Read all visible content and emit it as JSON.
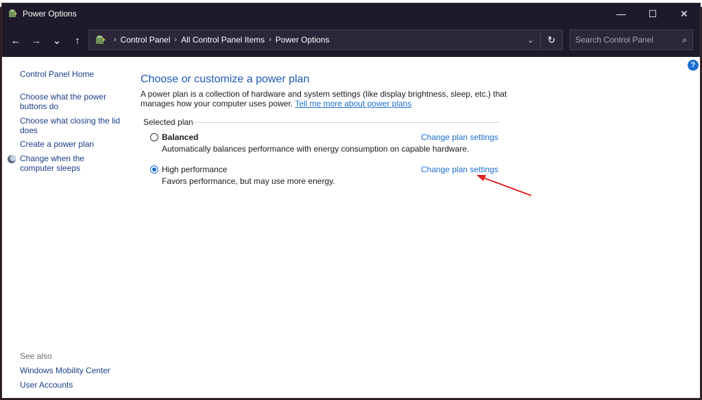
{
  "window": {
    "title": "Power Options",
    "controls": {
      "minimize": "—",
      "maximize": "☐",
      "close": "✕"
    }
  },
  "nav": {
    "back": "←",
    "forward": "→",
    "recent": "⌄",
    "up": "↑",
    "breadcrumbs": [
      "Control Panel",
      "All Control Panel Items",
      "Power Options"
    ],
    "dropdown": "⌄",
    "refresh": "↻"
  },
  "search": {
    "placeholder": "Search Control Panel",
    "icon": "⌕"
  },
  "help": {
    "label": "?"
  },
  "sidebar": {
    "home": "Control Panel Home",
    "items": [
      {
        "label": "Choose what the power buttons do"
      },
      {
        "label": "Choose what closing the lid does"
      },
      {
        "label": "Create a power plan"
      },
      {
        "label": "Change when the computer sleeps"
      }
    ],
    "see_also_label": "See also",
    "see_also": [
      {
        "label": "Windows Mobility Center"
      },
      {
        "label": "User Accounts"
      }
    ]
  },
  "main": {
    "title": "Choose or customize a power plan",
    "description": "A power plan is a collection of hardware and system settings (like display brightness, sleep, etc.) that manages how your computer uses power.",
    "learn_more": "Tell me more about power plans",
    "section_label": "Selected plan",
    "plans": [
      {
        "name": "Balanced",
        "description": "Automatically balances performance with energy consumption on capable hardware.",
        "selected": false,
        "link": "Change plan settings"
      },
      {
        "name": "High performance",
        "description": "Favors performance, but may use more energy.",
        "selected": true,
        "link": "Change plan settings"
      }
    ]
  },
  "colors": {
    "titlebar": "#1f1a2b",
    "link": "#1a6fd0",
    "title_blue": "#1e5ab4",
    "arrow": "#e02020"
  }
}
